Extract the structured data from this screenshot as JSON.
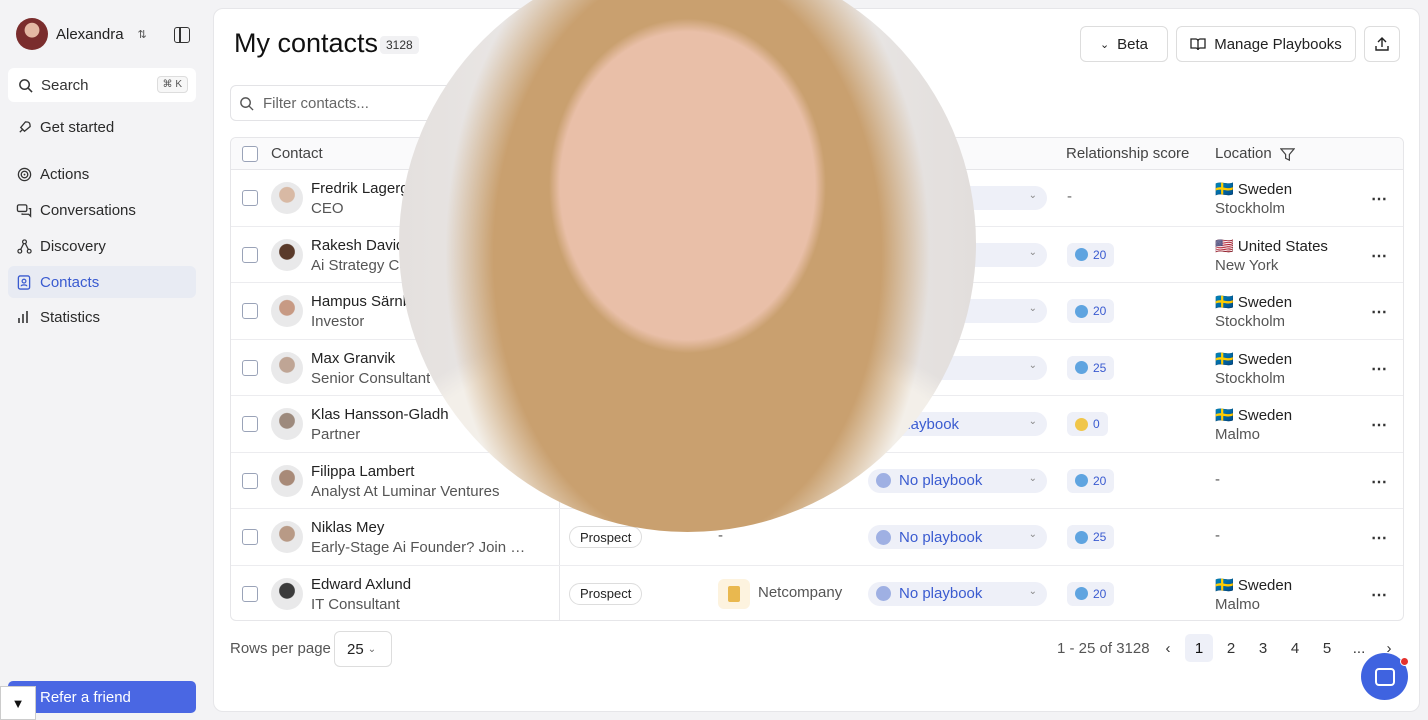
{
  "sidebar": {
    "user_name": "Alexandra",
    "search_label": "Search",
    "search_shortcut": "⌘ K",
    "items": [
      {
        "label": "Get started",
        "icon": "rocket-icon"
      },
      {
        "label": "Actions",
        "icon": "target-icon"
      },
      {
        "label": "Conversations",
        "icon": "chat-icon"
      },
      {
        "label": "Discovery",
        "icon": "discovery-icon"
      },
      {
        "label": "Contacts",
        "icon": "contacts-icon",
        "active": true
      },
      {
        "label": "Statistics",
        "icon": "bar-chart-icon"
      }
    ],
    "refer_label": "Refer a friend"
  },
  "header": {
    "title": "My contacts",
    "count": "3128",
    "beta_label": "Beta",
    "playbooks_label": "Manage Playbooks"
  },
  "filter": {
    "placeholder": "Filter contacts..."
  },
  "table": {
    "columns": {
      "contact": "Contact",
      "score": "Relationship score",
      "location": "Location"
    },
    "rows": [
      {
        "name": "Fredrik Lagergr",
        "title": "CEO",
        "stage": "",
        "company": "",
        "playbook": "book",
        "score": "-",
        "country": "Sweden",
        "flag": "🇸🇪",
        "city": "Stockholm"
      },
      {
        "name": "Rakesh David",
        "title": "Ai Strategy Co",
        "stage": "",
        "company": "",
        "playbook": "book",
        "score": "20",
        "country": "United States",
        "flag": "🇺🇸",
        "city": "New York"
      },
      {
        "name": "Hampus Särnb",
        "title": "Investor",
        "stage": "",
        "company": "",
        "playbook": "book",
        "score": "20",
        "country": "Sweden",
        "flag": "🇸🇪",
        "city": "Stockholm"
      },
      {
        "name": "Max Granvik",
        "title": "Senior Consultant",
        "stage": "",
        "company": "",
        "playbook": "book",
        "score": "25",
        "country": "Sweden",
        "flag": "🇸🇪",
        "city": "Stockholm"
      },
      {
        "name": "Klas Hansson-Gladh",
        "title": "Partner",
        "stage": "",
        "company": "",
        "playbook": "playbook",
        "score": "0",
        "country": "Sweden",
        "flag": "🇸🇪",
        "city": "Malmo"
      },
      {
        "name": "Filippa Lambert",
        "title": "Analyst At Luminar Ventures",
        "stage": "",
        "company": "",
        "playbook": "No playbook",
        "score": "20",
        "country": "-",
        "flag": "",
        "city": ""
      },
      {
        "name": "Niklas Mey",
        "title": "Early-Stage Ai Founder? Join Our...",
        "stage": "Prospect",
        "company": "-",
        "playbook": "No playbook",
        "score": "25",
        "country": "-",
        "flag": "",
        "city": ""
      },
      {
        "name": "Edward Axlund",
        "title": "IT Consultant",
        "stage": "Prospect",
        "company": "Netcompany",
        "playbook": "No playbook",
        "score": "20",
        "country": "Sweden",
        "flag": "🇸🇪",
        "city": "Malmo"
      }
    ]
  },
  "pagination": {
    "rows_per_page_label": "Rows per page",
    "rows_per_page": "25",
    "range": "1 - 25 of 3128",
    "pages": [
      "1",
      "2",
      "3",
      "4",
      "5",
      "..."
    ],
    "current": "1"
  },
  "colors": {
    "accent": "#4a67e3",
    "active_nav_bg": "#e8ebf3"
  }
}
